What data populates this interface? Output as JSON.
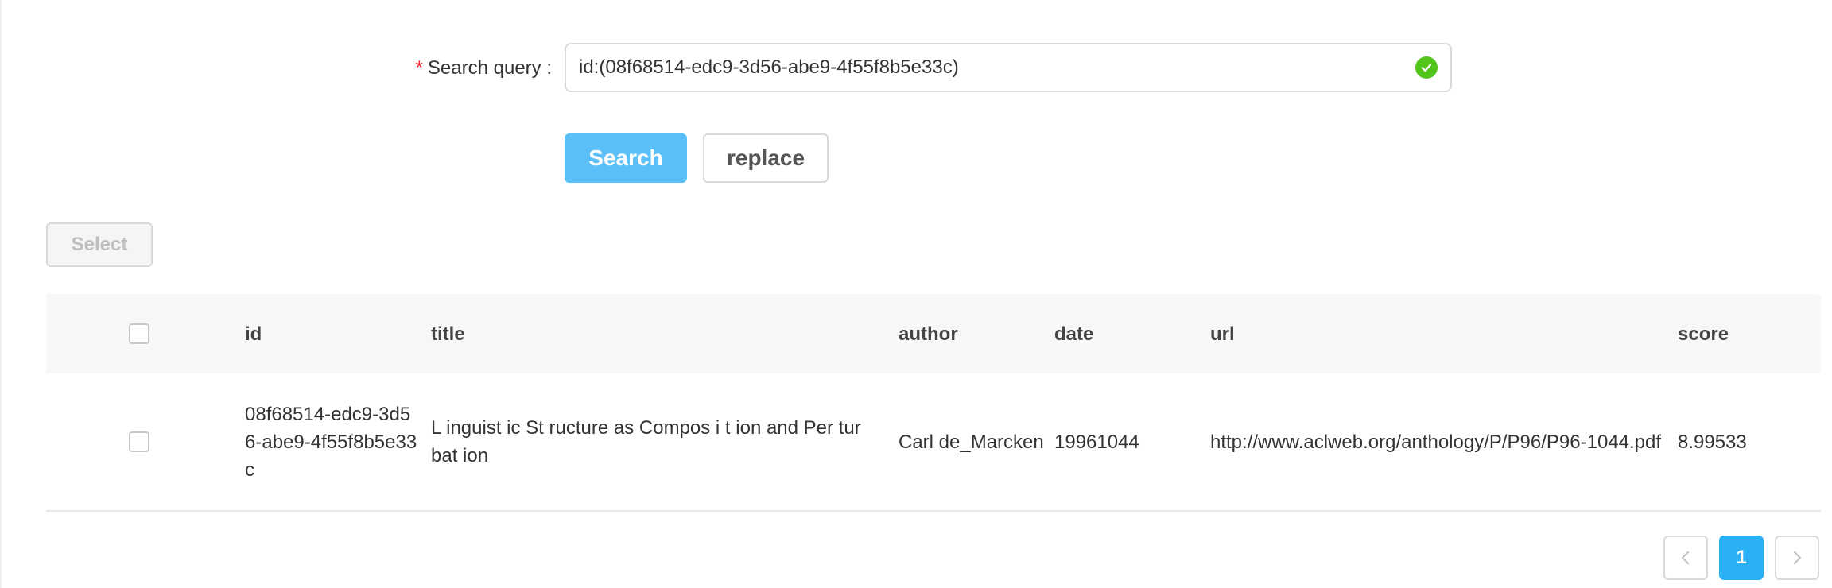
{
  "form": {
    "required_mark": "*",
    "label": "Search query :",
    "query_value": "id:(08f68514-edc9-3d56-abe9-4f55f8b5e33c)",
    "search_label": "Search",
    "replace_label": "replace",
    "valid_color": "#52c41a",
    "primary_color": "#5bc0f7"
  },
  "toolbar": {
    "select_label": "Select"
  },
  "table": {
    "columns": [
      "id",
      "title",
      "author",
      "date",
      "url",
      "score"
    ],
    "rows": [
      {
        "id": "08f68514-edc9-3d56-abe9-4f55f8b5e33c",
        "title": "L inguist ic St ructure as Compos i t ion and Per tur bat ion",
        "author": "Carl de_Marcken",
        "date": "19961044",
        "url": "http://www.aclweb.org/anthology/P/P96/P96-1044.pdf",
        "score": "8.99533"
      }
    ]
  },
  "pagination": {
    "current_page": "1",
    "active_color": "#2ab0f5"
  }
}
